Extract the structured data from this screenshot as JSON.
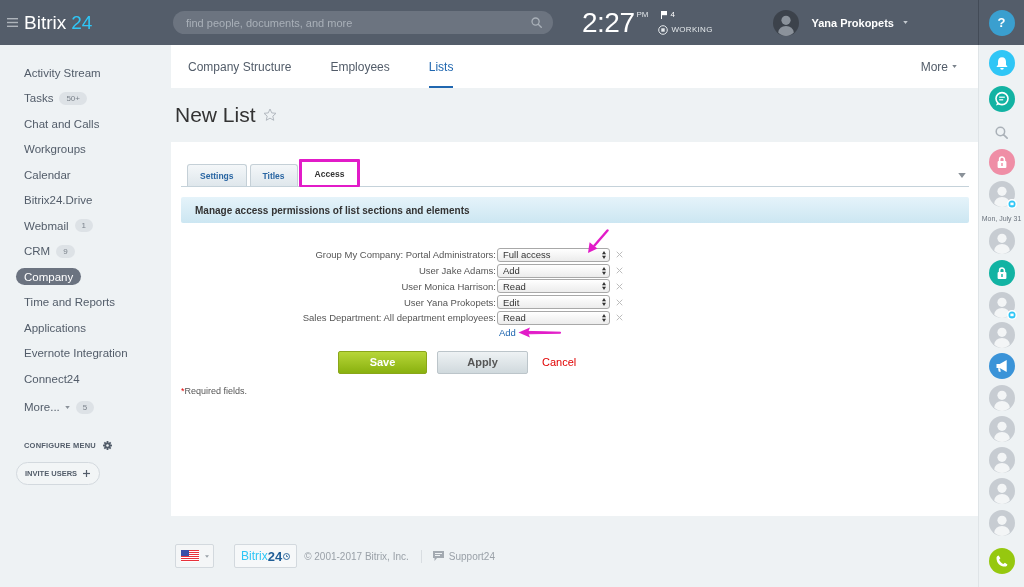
{
  "header": {
    "logo": {
      "name": "Bitrix",
      "number": "24"
    },
    "search": {
      "placeholder": "find people, documents, and more"
    },
    "clock": {
      "time": "2:27",
      "meridiem": "PM"
    },
    "flag_count": "4",
    "work_status": "WORKING",
    "user": {
      "name": "Yana Prokopets"
    }
  },
  "sidebar": {
    "items": [
      {
        "label": "Activity Stream",
        "selected": false,
        "kind": "link"
      },
      {
        "label": "Tasks",
        "counter": "50+",
        "selected": false,
        "kind": "link"
      },
      {
        "label": "Chat and Calls",
        "selected": false,
        "kind": "link"
      },
      {
        "label": "Workgroups",
        "selected": false,
        "kind": "link"
      },
      {
        "label": "Calendar",
        "selected": false,
        "kind": "link"
      },
      {
        "label": "Bitrix24.Drive",
        "selected": false,
        "kind": "link"
      },
      {
        "label": "Webmail",
        "counter": "1",
        "selected": false,
        "kind": "link"
      },
      {
        "label": "CRM",
        "counter": "9",
        "selected": false,
        "kind": "link"
      },
      {
        "label": "Company",
        "selected": true,
        "kind": "link"
      },
      {
        "label": "Time and Reports",
        "selected": false,
        "kind": "link"
      },
      {
        "label": "Applications",
        "selected": false,
        "kind": "link"
      },
      {
        "label": "Evernote Integration",
        "selected": false,
        "kind": "link"
      },
      {
        "label": "Connect24",
        "selected": false,
        "kind": "link"
      },
      {
        "label": "More...",
        "counter": "5",
        "selected": false,
        "kind": "more"
      }
    ],
    "configure_menu": "CONFIGURE MENU",
    "invite_button": "INVITE USERS"
  },
  "top_tabs": {
    "items": [
      {
        "label": "Company Structure",
        "selected": false
      },
      {
        "label": "Employees",
        "selected": false
      },
      {
        "label": "Lists",
        "selected": true
      }
    ],
    "more": "More"
  },
  "page": {
    "title": "New List",
    "favorite": false
  },
  "form": {
    "tabs": [
      {
        "label": "Settings",
        "selected": false,
        "highlighted": false
      },
      {
        "label": "Titles",
        "selected": false,
        "highlighted": false
      },
      {
        "label": "Access",
        "selected": true,
        "highlighted": true
      }
    ],
    "section_title": "Manage access permissions of list sections and elements",
    "permissions": [
      {
        "subject": "Group My Company: Portal Administrators:",
        "access": "Full access",
        "arrow": true
      },
      {
        "subject": "User Jake Adams:",
        "access": "Add",
        "arrow": false
      },
      {
        "subject": "User Monica Harrison:",
        "access": "Read",
        "arrow": false
      },
      {
        "subject": "User Yana Prokopets:",
        "access": "Edit",
        "arrow": false
      },
      {
        "subject": "Sales Department: All department employees:",
        "access": "Read",
        "arrow": false
      }
    ],
    "add_link": {
      "label": "Add",
      "arrow": true
    },
    "buttons": [
      {
        "label": "Save",
        "kind": "save"
      },
      {
        "label": "Apply",
        "kind": "apply"
      },
      {
        "label": "Cancel",
        "kind": "cancel"
      }
    ],
    "required_note": {
      "mark": "*",
      "text": "Required fields."
    }
  },
  "footer": {
    "logo": {
      "name": "Bitrix",
      "number": "24"
    },
    "copyright": "© 2001-2017 Bitrix, Inc.",
    "support": "Support24"
  },
  "right_bar": {
    "help": "?",
    "date": "Mon, July 31"
  }
}
